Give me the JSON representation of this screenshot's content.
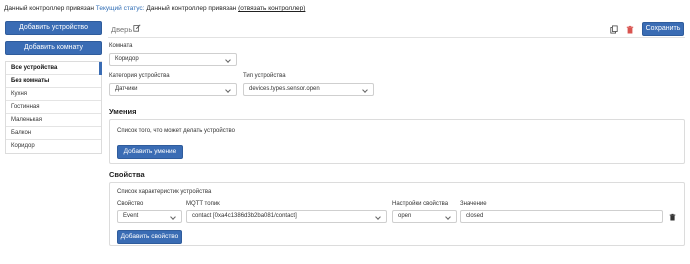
{
  "topbar": {
    "controller_text": "Данный контроллер привязан",
    "status_label": "Текущий статус:",
    "status_value": "Данный контроллер привязан",
    "unlink_label": "(отвязать контроллер)"
  },
  "sidebar": {
    "add_device_label": "Добавить устройство",
    "add_room_label": "Добавить комнату",
    "rooms": [
      {
        "label": "Все устройства"
      },
      {
        "label": "Без комнаты"
      },
      {
        "label": "Кухня"
      },
      {
        "label": "Гостинная"
      },
      {
        "label": "Маленькая"
      },
      {
        "label": "Балкон"
      },
      {
        "label": "Коридор"
      }
    ]
  },
  "device": {
    "name": "Дверь",
    "save_label": "Сохранить",
    "room_label": "Комната",
    "room_value": "Коридор",
    "category_label": "Категория устройства",
    "category_value": "Датчики",
    "type_label": "Тип устройства",
    "type_value": "devices.types.sensor.open"
  },
  "skills": {
    "title": "Умения",
    "description": "Список того, что может делать устройство",
    "add_label": "Добавить умение"
  },
  "properties": {
    "title": "Свойства",
    "description": "Список характеристик устройства",
    "col_property": "Свойство",
    "col_topic": "MQTT топик",
    "col_settings": "Настройки свойства",
    "col_value": "Значение",
    "row": {
      "property": "Event",
      "topic": "contact [0xa4c1386d3b2ba081/contact]",
      "settings": "open",
      "value": "closed"
    },
    "add_label": "Добавить свойство"
  },
  "colors": {
    "accent": "#3a6cb4",
    "delete": "#d9534f"
  }
}
